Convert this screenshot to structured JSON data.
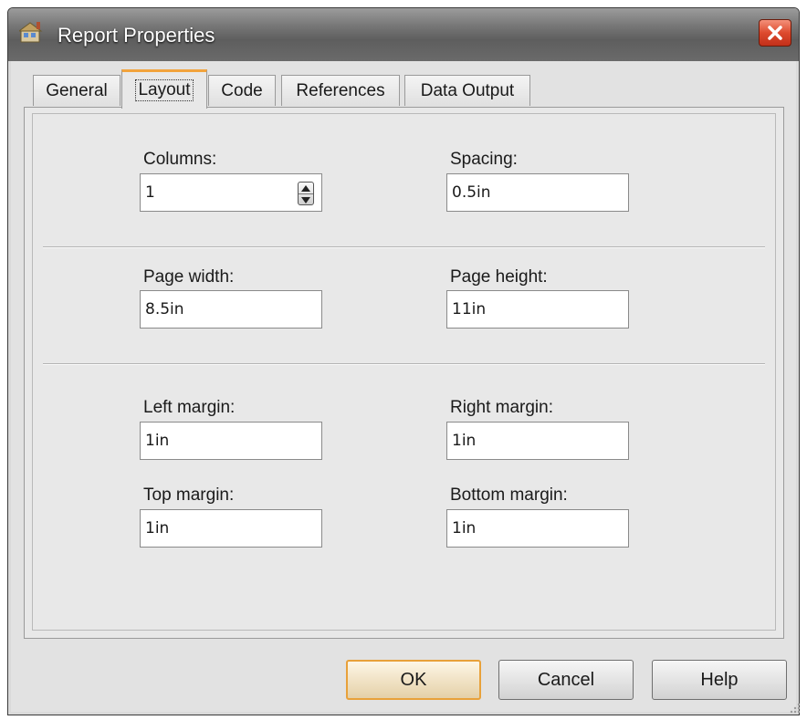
{
  "window": {
    "title": "Report Properties",
    "title_icon": "report-icon",
    "close_icon": "close-icon"
  },
  "tabs": [
    {
      "label": "General",
      "active": false
    },
    {
      "label": "Layout",
      "active": true
    },
    {
      "label": "Code",
      "active": false
    },
    {
      "label": "References",
      "active": false
    },
    {
      "label": "Data Output",
      "active": false
    }
  ],
  "layout": {
    "columns": {
      "label": "Columns:",
      "value": "1"
    },
    "spacing": {
      "label": "Spacing:",
      "value": "0.5in"
    },
    "page_width": {
      "label": "Page width:",
      "value": "8.5in"
    },
    "page_height": {
      "label": "Page height:",
      "value": "11in"
    },
    "left_margin": {
      "label": "Left margin:",
      "value": "1in"
    },
    "right_margin": {
      "label": "Right margin:",
      "value": "1in"
    },
    "top_margin": {
      "label": "Top margin:",
      "value": "1in"
    },
    "bottom_margin": {
      "label": "Bottom margin:",
      "value": "1in"
    }
  },
  "buttons": {
    "ok": "OK",
    "cancel": "Cancel",
    "help": "Help"
  },
  "colors": {
    "default_button_border": "#e8a13a",
    "active_tab_accent": "#f2a33c",
    "close_button": "#dd4a2e"
  }
}
